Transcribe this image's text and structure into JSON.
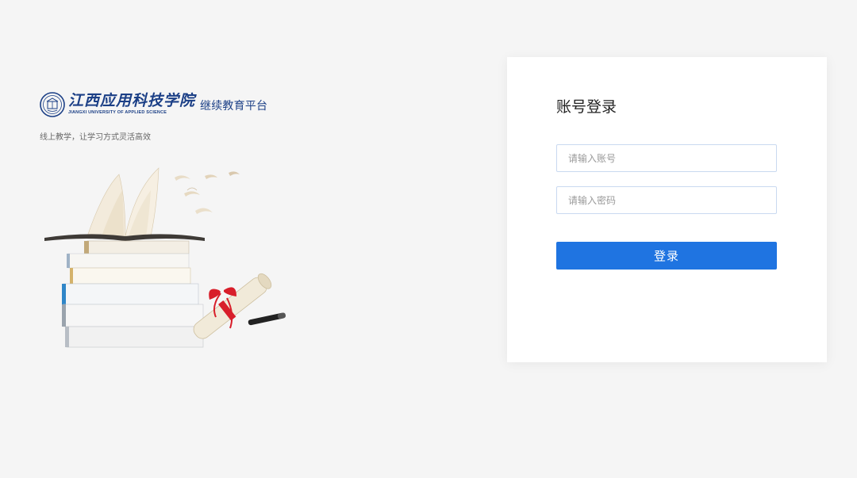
{
  "brand": {
    "school_name_cn": "江西应用科技学院",
    "school_name_en": "JIANGXI UNIVERSITY OF APPLIED SCIENCE",
    "platform_name": "继续教育平台",
    "slogan": "线上教学，让学习方式灵活高效",
    "colors": {
      "brand_blue": "#1b3f86"
    }
  },
  "illustration": {
    "icon": "books-diploma-illustration"
  },
  "login": {
    "title": "账号登录",
    "account_placeholder": "请输入账号",
    "password_placeholder": "请输入密码",
    "submit_label": "登录",
    "colors": {
      "button": "#1f74e1",
      "input_border": "#c9d9f0"
    }
  }
}
